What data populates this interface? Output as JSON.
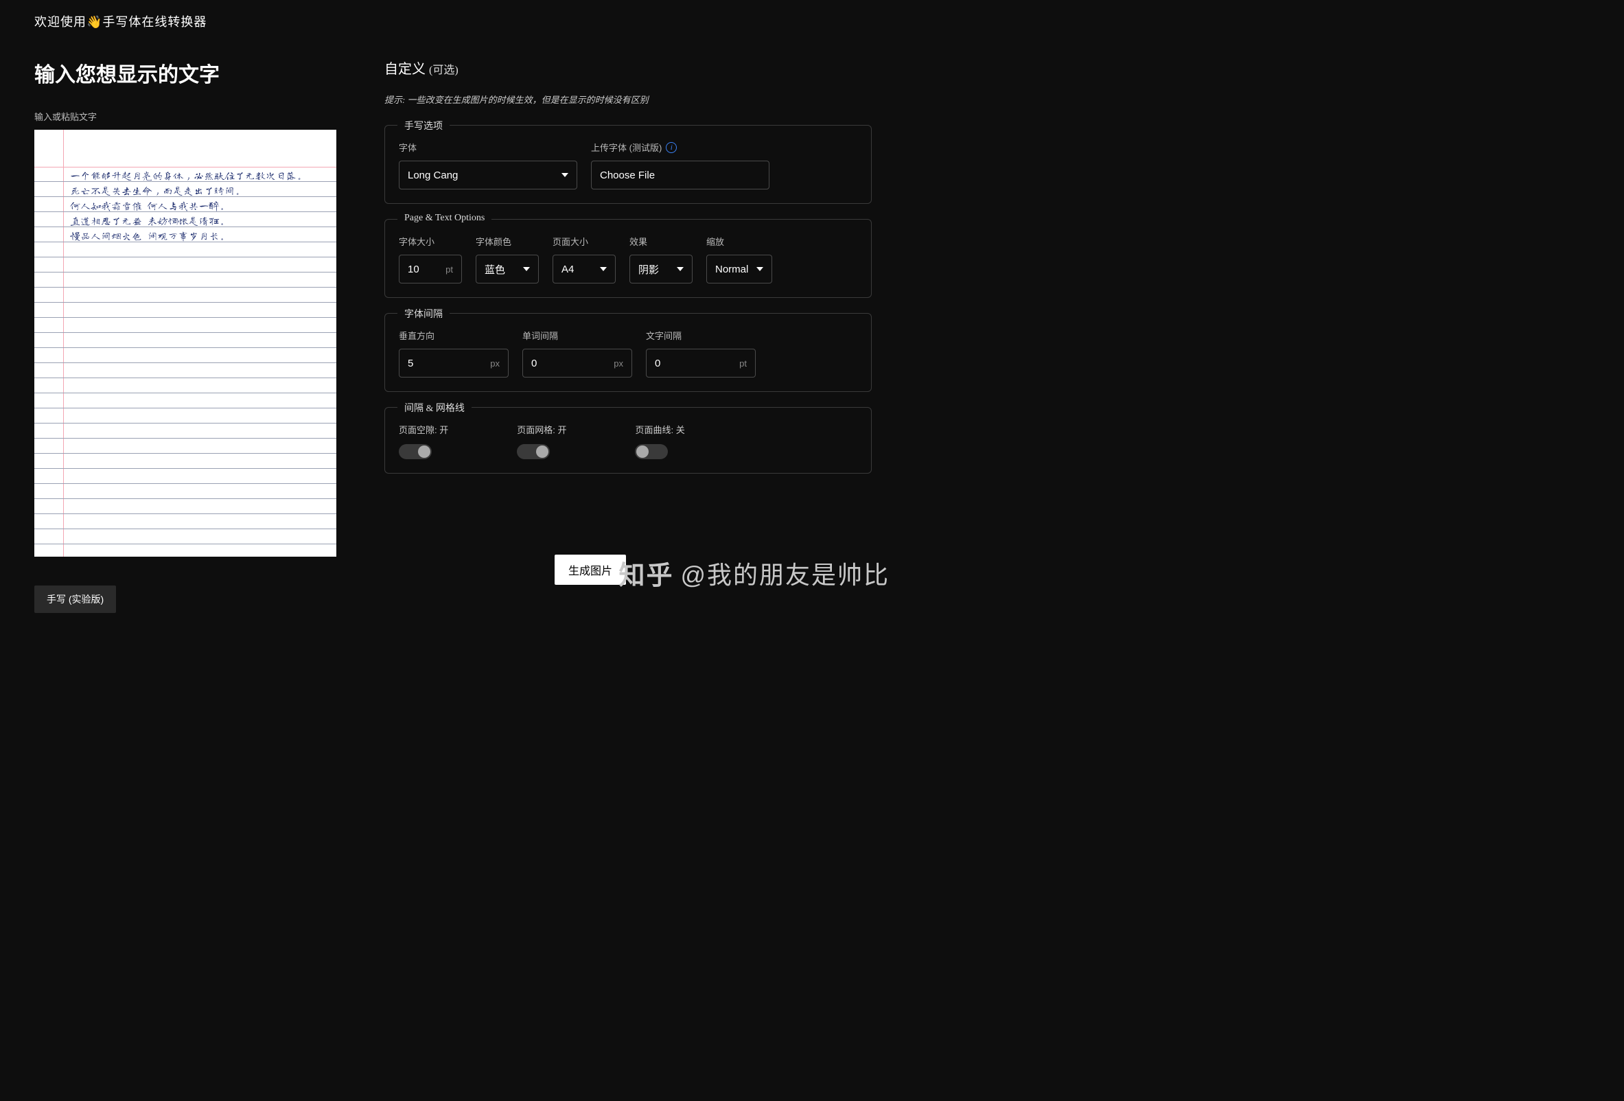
{
  "header": "欢迎使用👋手写体在线转换器",
  "left": {
    "title": "输入您想显示的文字",
    "input_label": "输入或粘贴文字",
    "sample_text": "一个能够升起月亮的身体，必然驮住了无数次日落。\n死亡不是失去生命，而是走出了时间。\n何人知我霜雪催 何人与我共一醉。\n直道相思了无益 未妨惆怅是清狂。\n慢品人间烟火色 闲观万事岁月长。",
    "handwrite_btn": "手写 (实验版)"
  },
  "right": {
    "title": "自定义",
    "title_sub": "(可选)",
    "hint": "提示: 一些改变在生成图片的时候生效，但是在显示的时候没有区别",
    "section1": {
      "legend": "手写选项",
      "font_label": "字体",
      "font_value": "Long Cang",
      "upload_label": "上传字体 (测试版)",
      "choose_file": "Choose File"
    },
    "section2": {
      "legend": "Page & Text Options",
      "fontsize_label": "字体大小",
      "fontsize_value": "10",
      "fontsize_unit": "pt",
      "color_label": "字体颜色",
      "color_value": "蓝色",
      "pagesize_label": "页面大小",
      "pagesize_value": "A4",
      "effect_label": "效果",
      "effect_value": "阴影",
      "zoom_label": "缩放",
      "zoom_value": "Normal"
    },
    "section3": {
      "legend": "字体间隔",
      "vert_label": "垂直方向",
      "vert_value": "5",
      "vert_unit": "px",
      "word_label": "单词间隔",
      "word_value": "0",
      "word_unit": "px",
      "char_label": "文字间隔",
      "char_value": "0",
      "char_unit": "pt"
    },
    "section4": {
      "legend": "间隔 & 网格线",
      "margin_label": "页面空隙: 开",
      "grid_label": "页面网格: 开",
      "curve_label": "页面曲线: 关"
    },
    "generate_btn": "生成图片"
  },
  "watermark": {
    "logo": "知乎",
    "text": "@我的朋友是帅比"
  }
}
